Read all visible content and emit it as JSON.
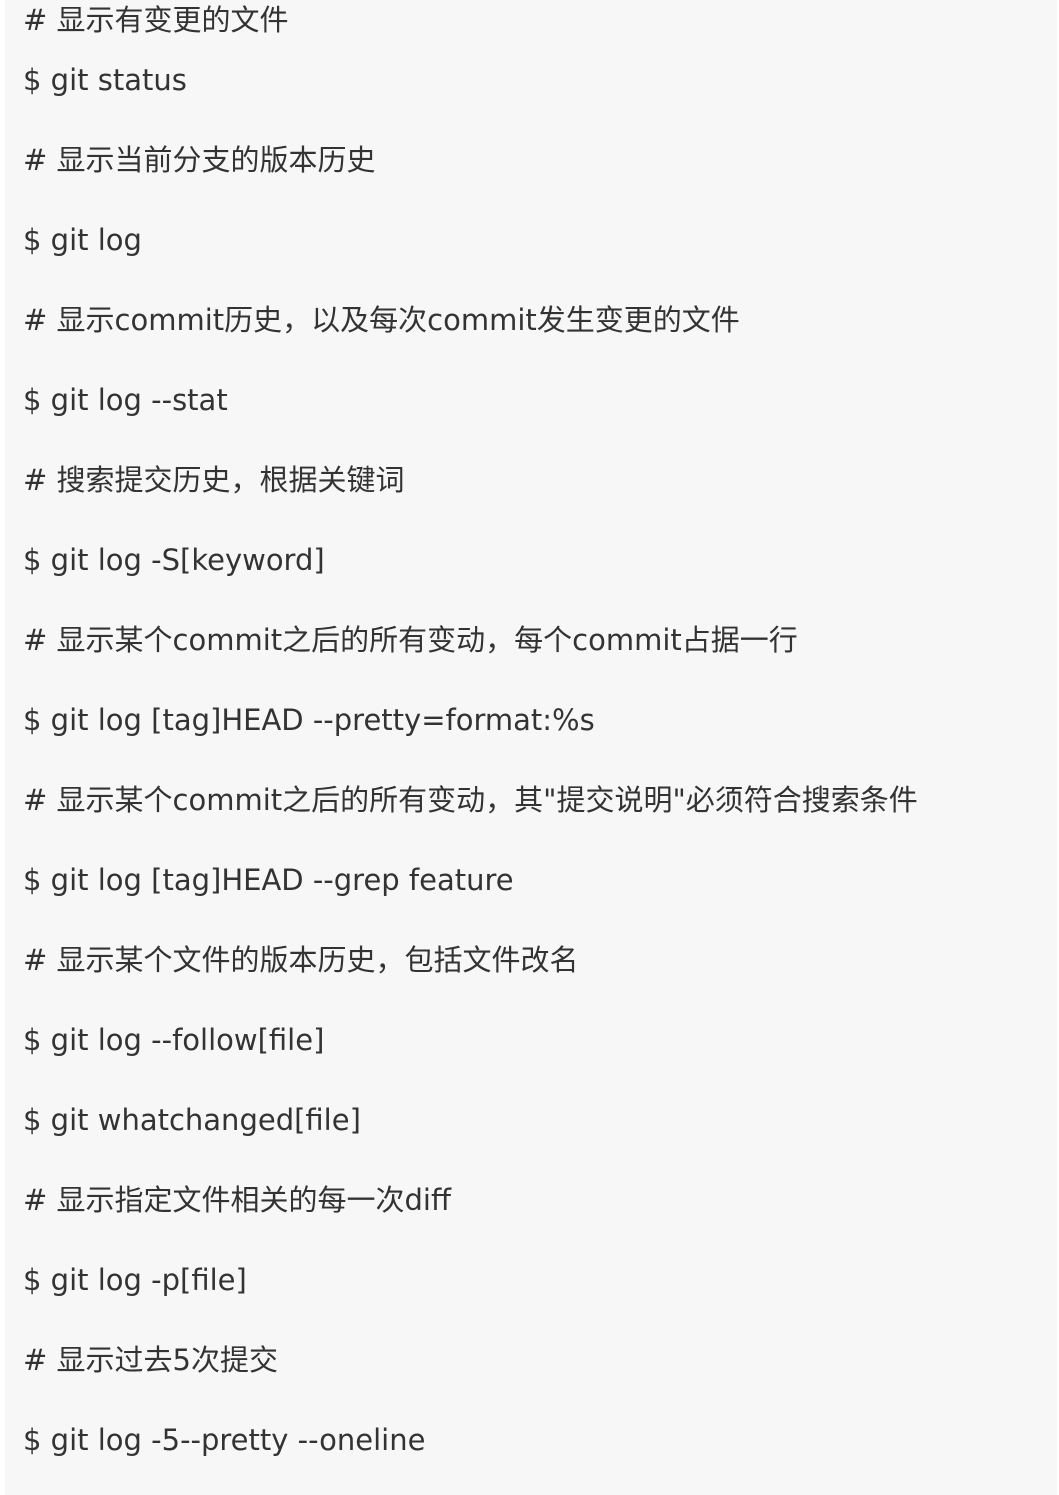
{
  "lines": [
    "# 显示有变更的文件",
    "$ git status",
    "# 显示当前分支的版本历史",
    "$ git log",
    "# 显示commit历史，以及每次commit发生变更的文件",
    "$ git log --stat",
    "# 搜索提交历史，根据关键词",
    "$ git log -S[keyword]",
    "# 显示某个commit之后的所有变动，每个commit占据一行",
    "$ git log [tag]HEAD --pretty=format:%s",
    "# 显示某个commit之后的所有变动，其\"提交说明\"必须符合搜索条件",
    "$ git log [tag]HEAD --grep feature",
    "# 显示某个文件的版本历史，包括文件改名",
    "$ git log --follow[file]",
    "$ git whatchanged[file]",
    "# 显示指定文件相关的每一次diff",
    "$ git log -p[file]",
    "# 显示过去5次提交",
    "$ git log -5--pretty --oneline"
  ]
}
